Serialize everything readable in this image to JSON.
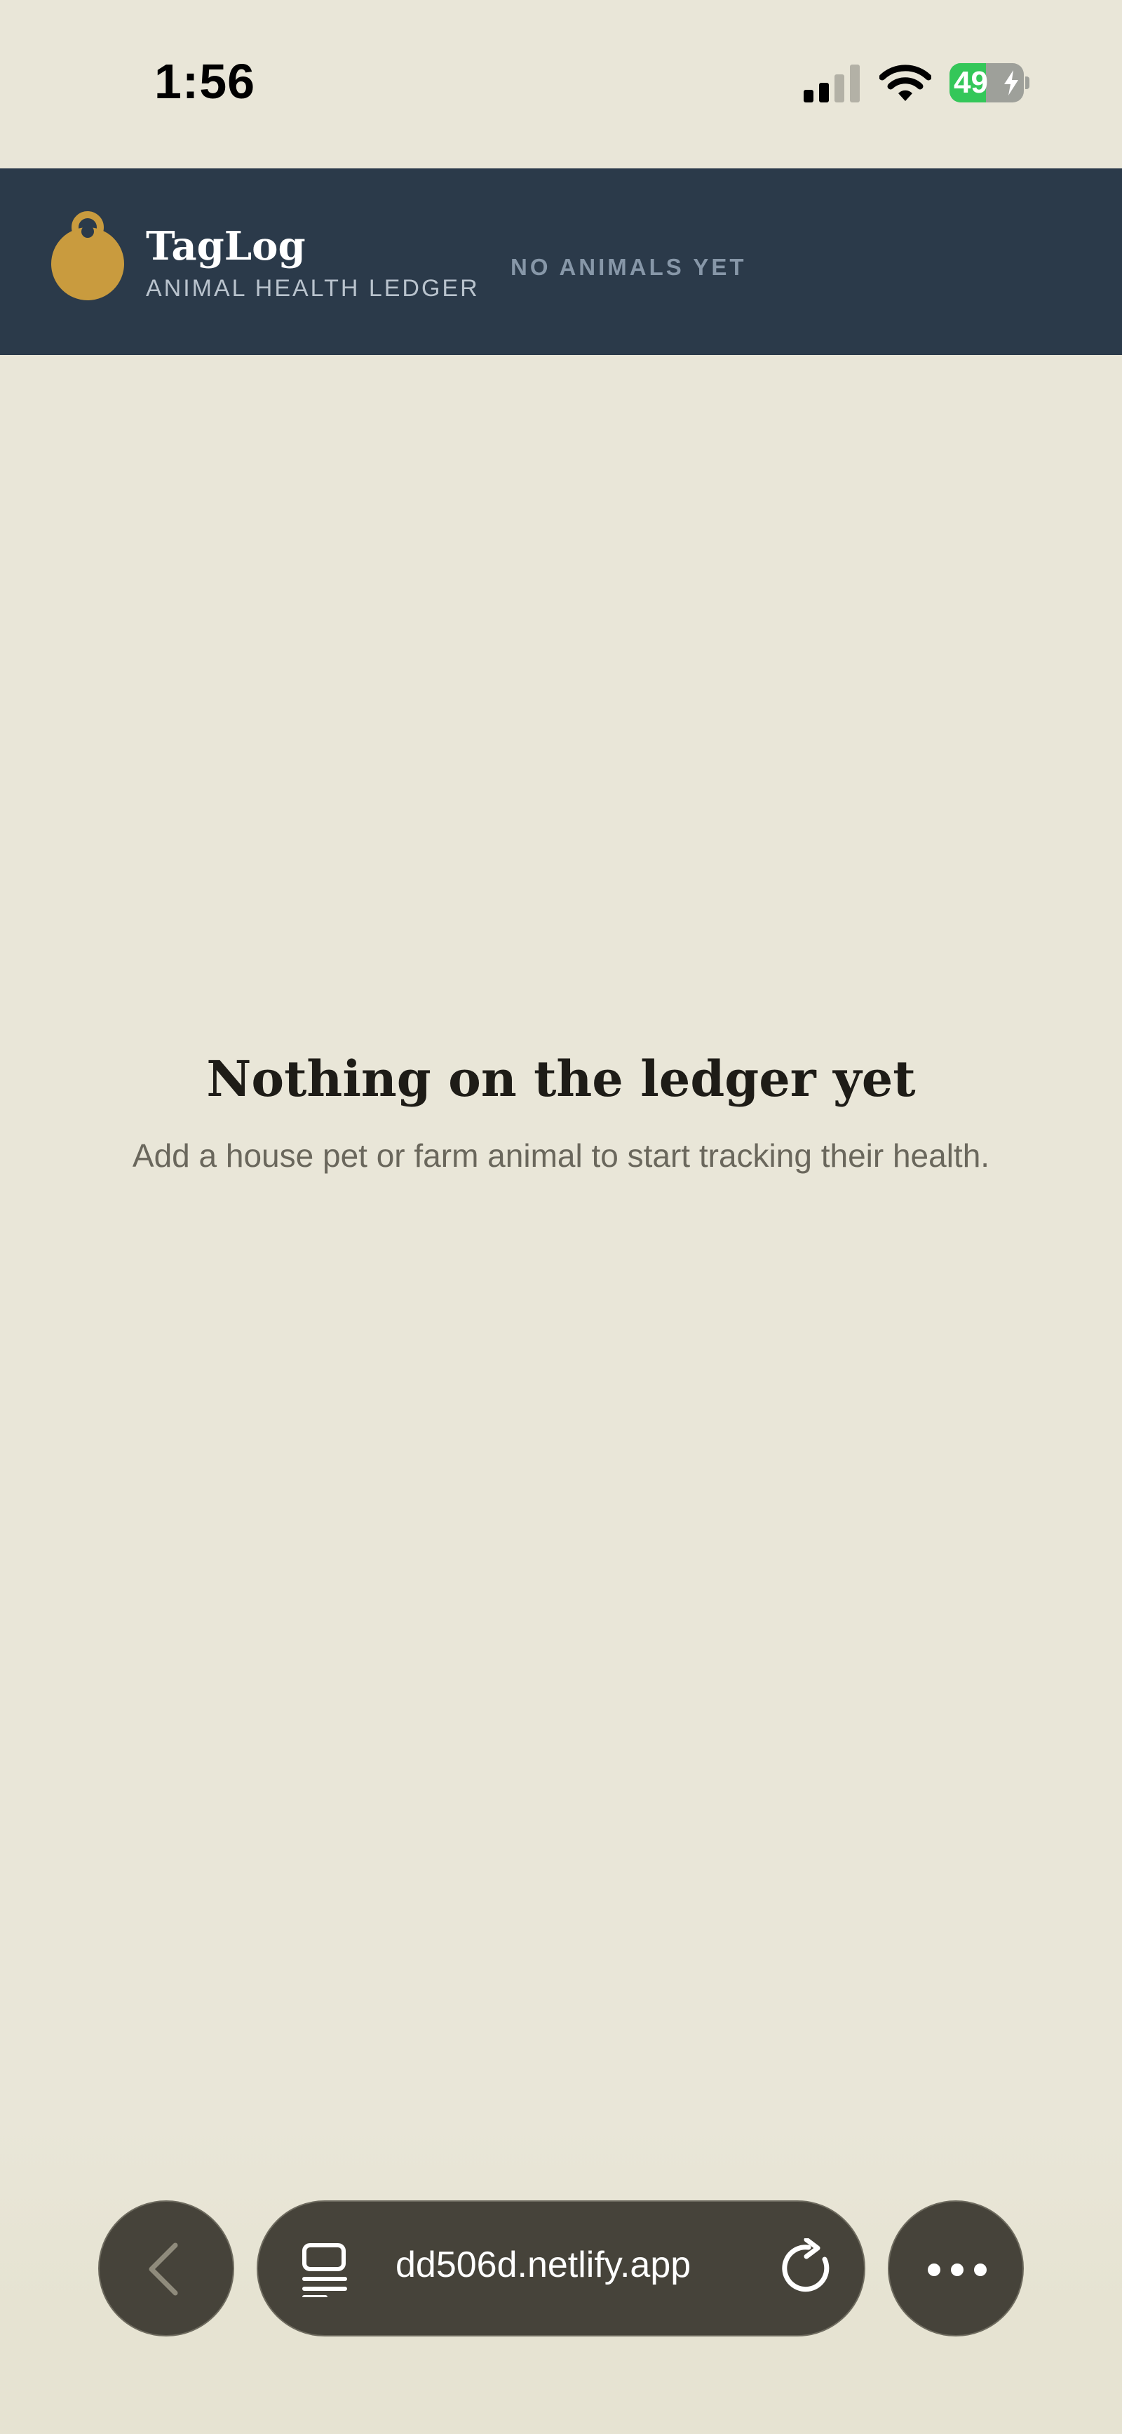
{
  "status_bar": {
    "time": "1:56",
    "battery_level": "49",
    "battery_fraction": 0.49,
    "signal_icon": "cellular-signal-icon",
    "wifi_icon": "wifi-icon",
    "charging_icon": "bolt-icon"
  },
  "header": {
    "icon": "animal-tag-icon",
    "title": "TagLog",
    "subtitle": "ANIMAL HEALTH LEDGER",
    "animal_count_label": "NO ANIMALS YET"
  },
  "empty_state": {
    "title": "Nothing on the ledger yet",
    "message": "Add a house pet or farm animal to start tracking their health."
  },
  "browser_bar": {
    "back_icon": "chevron-left-icon",
    "tabs_icon": "tabs-icon",
    "url": "dd506d.netlify.app",
    "reload_icon": "reload-icon",
    "more_icon": "more-icon"
  },
  "colors": {
    "background": "#e9e6d8",
    "header_bg": "#2b3a4a",
    "tag_accent": "#c99b3e",
    "battery_green": "#34c759",
    "toolbar_bg": "#46433a"
  }
}
